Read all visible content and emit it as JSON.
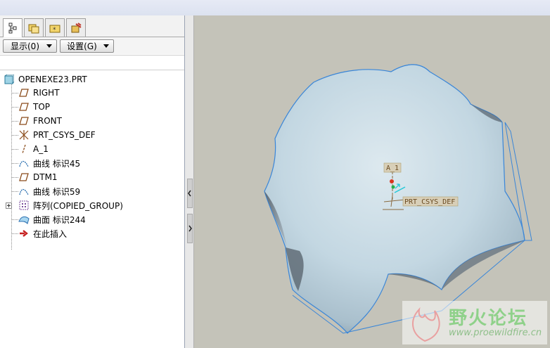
{
  "left_panel": {
    "toolbar": {
      "show_label": "显示(0)",
      "settings_label": "设置(G)"
    },
    "tree": {
      "root": "OPENEXE23.PRT",
      "items": [
        {
          "label": "RIGHT",
          "icon": "datum-plane-icon"
        },
        {
          "label": "TOP",
          "icon": "datum-plane-icon"
        },
        {
          "label": "FRONT",
          "icon": "datum-plane-icon"
        },
        {
          "label": "PRT_CSYS_DEF",
          "icon": "coordinate-system-icon"
        },
        {
          "label": "A_1",
          "icon": "datum-axis-icon"
        },
        {
          "label": "曲线 标识45",
          "icon": "curve-icon"
        },
        {
          "label": "DTM1",
          "icon": "datum-plane-icon"
        },
        {
          "label": "曲线 标识59",
          "icon": "curve-icon"
        },
        {
          "label": "阵列(COPIED_GROUP)",
          "icon": "pattern-icon"
        },
        {
          "label": "曲面 标识244",
          "icon": "surface-icon"
        },
        {
          "label": "在此插入",
          "icon": "insert-here-arrow-icon"
        }
      ]
    }
  },
  "viewport": {
    "axis_label": "A_1",
    "csys_label": "PRT_CSYS_DEF",
    "watermark": {
      "title": "野火论坛",
      "url": "www.proewildfire.cn"
    }
  },
  "colors": {
    "background": "#c4c3b9",
    "edge": "#3a86d8",
    "accent": "#d9361f"
  }
}
